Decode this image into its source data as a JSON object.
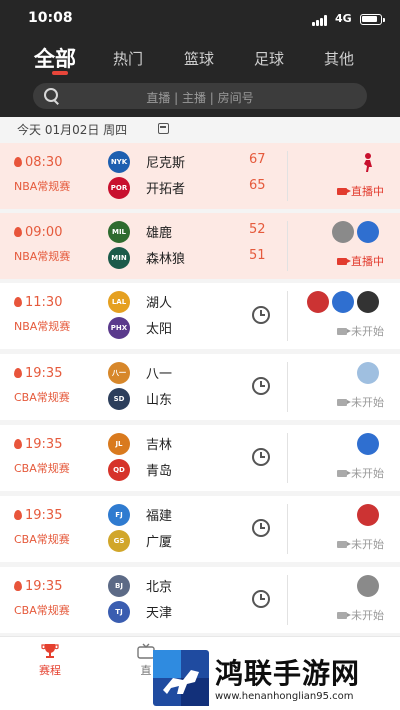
{
  "status_bar": {
    "time": "10:08",
    "network": "4G"
  },
  "tabs": [
    {
      "label": "全部",
      "active": true
    },
    {
      "label": "热门"
    },
    {
      "label": "篮球"
    },
    {
      "label": "足球"
    },
    {
      "label": "其他"
    }
  ],
  "search": {
    "placeholder": "直播 | 主播 | 房间号"
  },
  "date_bar": {
    "text": "今天 01月02日 周四"
  },
  "matches": [
    {
      "time": "08:30",
      "league": "NBA常规赛",
      "state": "live",
      "home": {
        "abbr": "NYK",
        "name": "尼克斯",
        "score": "67",
        "color": "#1d5fb0"
      },
      "away": {
        "abbr": "POR",
        "name": "开拓者",
        "score": "65",
        "color": "#c8102e"
      },
      "status": "直播中"
    },
    {
      "time": "09:00",
      "league": "NBA常规赛",
      "state": "live",
      "home": {
        "abbr": "MIL",
        "name": "雄鹿",
        "score": "52",
        "color": "#2e6b2f"
      },
      "away": {
        "abbr": "MIN",
        "name": "森林狼",
        "score": "51",
        "color": "#1b5a4a"
      },
      "status": "直播中"
    },
    {
      "time": "11:30",
      "league": "NBA常规赛",
      "state": "upcoming",
      "home": {
        "abbr": "LAL",
        "name": "湖人",
        "color": "#e5a020"
      },
      "away": {
        "abbr": "PHX",
        "name": "太阳",
        "color": "#5a3a8c"
      },
      "status": "未开始"
    },
    {
      "time": "19:35",
      "league": "CBA常规赛",
      "state": "upcoming",
      "home": {
        "abbr": "八一",
        "name": "八一",
        "color": "#d7872a"
      },
      "away": {
        "abbr": "SD",
        "name": "山东",
        "color": "#2d3f5c"
      },
      "status": "未开始"
    },
    {
      "time": "19:35",
      "league": "CBA常规赛",
      "state": "upcoming",
      "home": {
        "abbr": "JL",
        "name": "吉林",
        "color": "#d97a1e"
      },
      "away": {
        "abbr": "QD",
        "name": "青岛",
        "color": "#d6332a"
      },
      "status": "未开始"
    },
    {
      "time": "19:35",
      "league": "CBA常规赛",
      "state": "upcoming",
      "home": {
        "abbr": "FJ",
        "name": "福建",
        "color": "#2f7bd0"
      },
      "away": {
        "abbr": "GS",
        "name": "广厦",
        "color": "#d1a62a"
      },
      "status": "未开始"
    },
    {
      "time": "19:35",
      "league": "CBA常规赛",
      "state": "upcoming",
      "home": {
        "abbr": "BJ",
        "name": "北京",
        "color": "#5c6a86"
      },
      "away": {
        "abbr": "TJ",
        "name": "天津",
        "color": "#3a5db0"
      },
      "status": "未开始"
    }
  ],
  "bottom_nav": [
    {
      "label": "赛程",
      "icon": "trophy-icon",
      "active": true
    },
    {
      "label": "直",
      "icon": "tv-icon"
    }
  ],
  "watermark": {
    "title": "鸿联手游网",
    "url": "www.henanhonglian95.com"
  },
  "colors": {
    "accent": "#e8463a",
    "header_bg": "#262626",
    "live_row": "#fde9e4",
    "text_red": "#e55a3c"
  }
}
